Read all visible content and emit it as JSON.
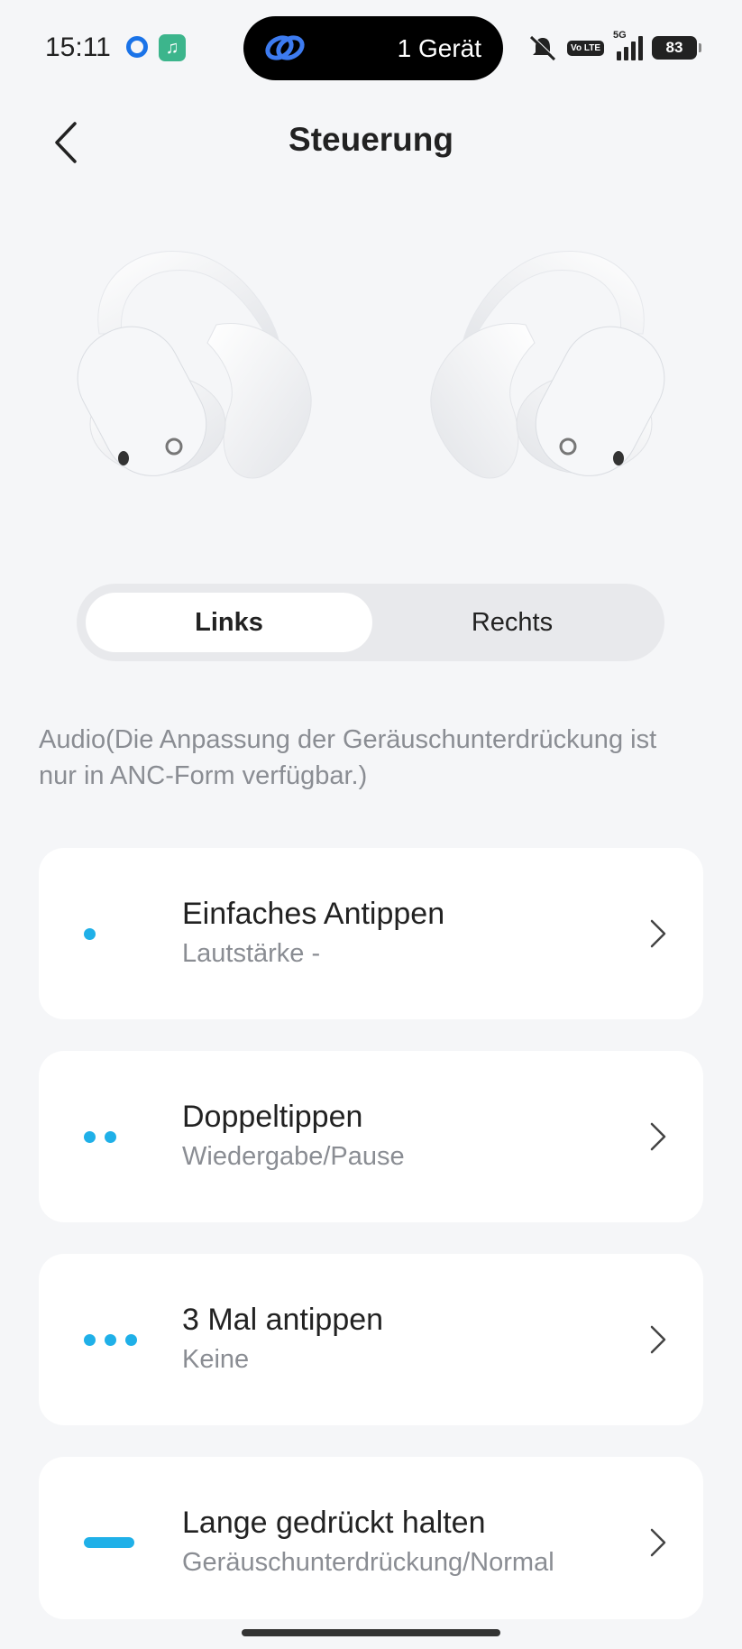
{
  "status_bar": {
    "time": "15:11",
    "island_text": "1 Gerät",
    "network": "5G",
    "volte": "Vo LTE",
    "battery": "83"
  },
  "header": {
    "title": "Steuerung"
  },
  "segment": {
    "left_label": "Links",
    "right_label": "Rechts",
    "selected": "Links"
  },
  "section": {
    "caption": "Audio(Die Anpassung der Geräuschunterdrückung ist nur in ANC-Form verfügbar.)"
  },
  "controls": [
    {
      "title": "Einfaches Antippen",
      "value": "Lautstärke -",
      "icon": "single-tap-icon"
    },
    {
      "title": "Doppeltippen",
      "value": "Wiedergabe/Pause",
      "icon": "double-tap-icon"
    },
    {
      "title": "3 Mal antippen",
      "value": "Keine",
      "icon": "triple-tap-icon"
    },
    {
      "title": "Lange gedrückt halten",
      "value": "Geräuschunterdrückung/Normal",
      "icon": "long-press-icon"
    }
  ],
  "colors": {
    "accent": "#1fb0e8",
    "background": "#f5f6f8",
    "card": "#ffffff",
    "secondary_text": "#8a8d93"
  }
}
